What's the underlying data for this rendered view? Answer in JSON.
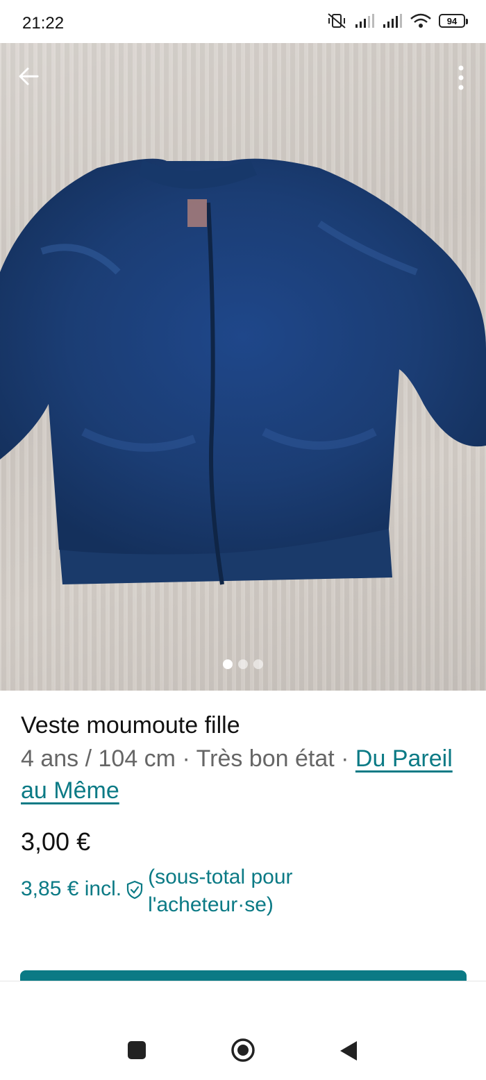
{
  "status_bar": {
    "time": "21:22",
    "battery": "94",
    "icons": [
      "muted-vibrate-icon",
      "signal-icon",
      "signal-icon",
      "wifi-icon",
      "battery-icon"
    ]
  },
  "photo": {
    "description_icon": "jacket-photo",
    "page_count": 3,
    "active_page": 1
  },
  "item": {
    "title": "Veste moumoute fille",
    "size_condition": "4 ans / 104 cm · Très bon état · ",
    "brand": "Du Pareil au Même",
    "price": "3,00 €",
    "price_incl": "3,85 € incl.",
    "price_incl_note": "(sous-total pour l'acheteur·se)"
  },
  "colors": {
    "accent": "#0b7a85",
    "jacket": "#1c3f73"
  }
}
